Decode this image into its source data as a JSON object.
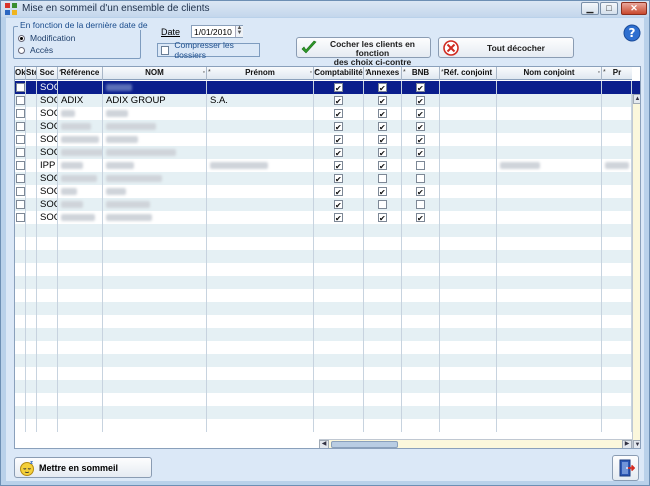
{
  "window": {
    "title": "Mise en sommeil d'un ensemble de clients"
  },
  "controls": {
    "group_label": "En fonction de la dernière date de",
    "radio_options": [
      {
        "label": "Modification",
        "selected": true
      },
      {
        "label": "Accès",
        "selected": false
      }
    ],
    "date_label": "Date",
    "date_value": "1/01/2010",
    "compress_label": "Compresser les dossiers",
    "compress_checked": false,
    "check_clients_line1": "Cocher les clients en fonction",
    "check_clients_line2": "des choix ci-contre",
    "uncheck_all_label": "Tout décocher"
  },
  "grid": {
    "columns": [
      "Ok",
      "Sté",
      "Soc",
      "Référence",
      "NOM",
      "Prénom",
      "Comptabilité",
      "Annexes",
      "BNB",
      "Réf. conjoint",
      "Nom conjoint",
      "Pr"
    ],
    "rows": [
      {
        "ok": false,
        "type": "SOC",
        "ref": "",
        "nom": "",
        "prenom": "",
        "compta": true,
        "annexes": true,
        "bnb": true,
        "selected": true
      },
      {
        "ok": false,
        "type": "SOC",
        "ref": "ADIX",
        "nom": "ADIX GROUP",
        "prenom": "S.A.",
        "compta": true,
        "annexes": true,
        "bnb": true,
        "selected": false
      },
      {
        "ok": false,
        "type": "SOC",
        "ref": "",
        "nom": "",
        "prenom": "",
        "compta": true,
        "annexes": true,
        "bnb": true,
        "selected": false
      },
      {
        "ok": false,
        "type": "SOC",
        "ref": "",
        "nom": "",
        "prenom": "",
        "compta": true,
        "annexes": true,
        "bnb": true,
        "selected": false
      },
      {
        "ok": false,
        "type": "SOC",
        "ref": "",
        "nom": "",
        "prenom": "",
        "compta": true,
        "annexes": true,
        "bnb": true,
        "selected": false
      },
      {
        "ok": false,
        "type": "SOC",
        "ref": "",
        "nom": "",
        "prenom": "",
        "compta": true,
        "annexes": true,
        "bnb": true,
        "selected": false
      },
      {
        "ok": false,
        "type": "IPP",
        "ref": "",
        "nom": "",
        "prenom": "",
        "compta": true,
        "annexes": true,
        "bnb": false,
        "selected": false
      },
      {
        "ok": false,
        "type": "SOC",
        "ref": "",
        "nom": "",
        "prenom": "",
        "compta": true,
        "annexes": false,
        "bnb": false,
        "selected": false
      },
      {
        "ok": false,
        "type": "SOC",
        "ref": "",
        "nom": "",
        "prenom": "",
        "compta": true,
        "annexes": true,
        "bnb": true,
        "selected": false
      },
      {
        "ok": false,
        "type": "SOC",
        "ref": "",
        "nom": "",
        "prenom": "",
        "compta": true,
        "annexes": false,
        "bnb": false,
        "selected": false
      },
      {
        "ok": false,
        "type": "SOC",
        "ref": "",
        "nom": "",
        "prenom": "",
        "compta": true,
        "annexes": true,
        "bnb": true,
        "selected": false
      }
    ]
  },
  "footer": {
    "sleep_button_label": "Mettre en sommeil"
  },
  "icons": {
    "app": "app-grid-icon",
    "help": "help-icon",
    "check": "green-check-icon",
    "uncheck": "red-cross-icon",
    "sleep": "sleeping-face-icon",
    "exit": "exit-door-icon"
  },
  "colors": {
    "selection": "#0a1e8c",
    "row_alt": "#e5f0f4",
    "client_bg": "#dbe8f7"
  }
}
